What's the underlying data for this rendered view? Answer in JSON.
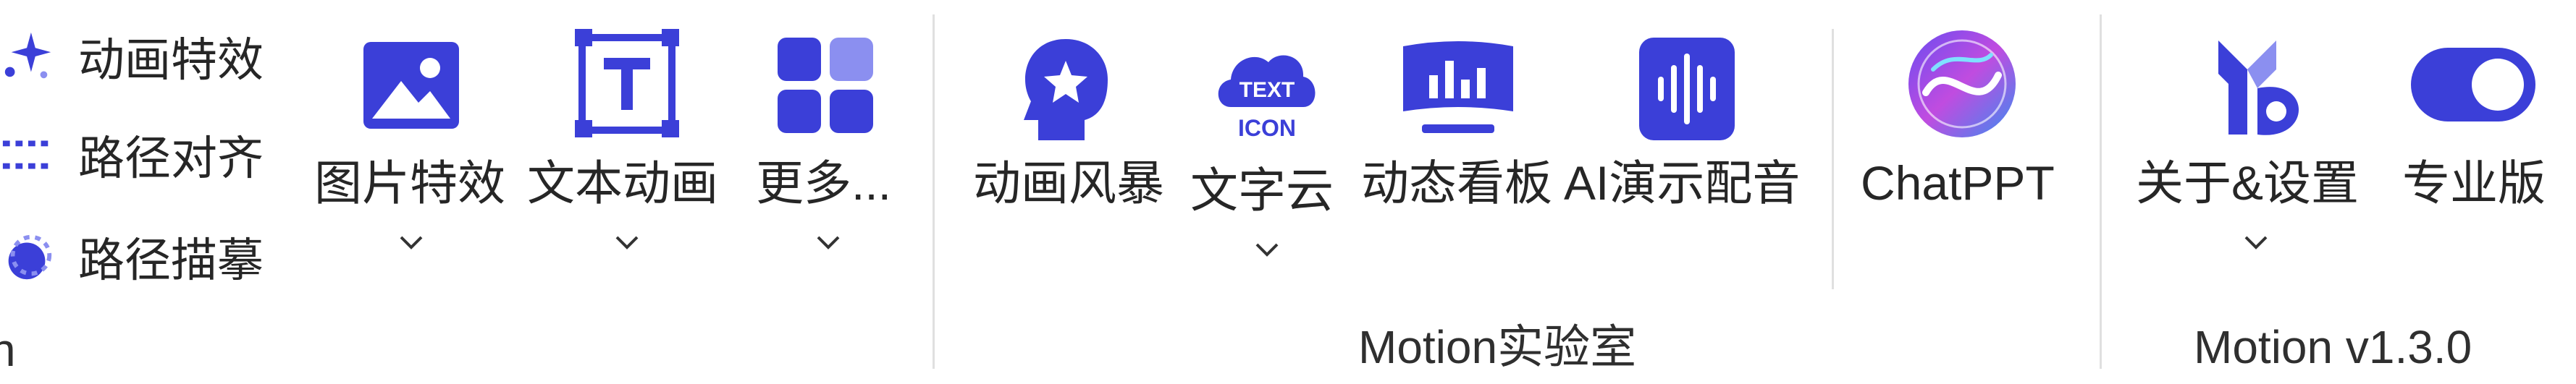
{
  "left_column": {
    "items": [
      {
        "label": "动画特效",
        "icon": "sparkle-icon"
      },
      {
        "label": "路径对齐",
        "icon": "align-path-icon"
      },
      {
        "label": "路径描摹",
        "icon": "trace-path-icon"
      }
    ],
    "clipped_group_title": "n"
  },
  "group1": {
    "buttons": [
      {
        "label": "图片特效",
        "icon": "image-icon"
      },
      {
        "label": "文本动画",
        "icon": "text-box-icon"
      },
      {
        "label": "更多...",
        "icon": "grid-apps-icon"
      }
    ]
  },
  "group2": {
    "buttons": [
      {
        "label": "动画风暴",
        "icon": "head-star-icon"
      },
      {
        "label": "文字云",
        "icon": "text-cloud-icon",
        "icon_text_top": "TEXT",
        "icon_text_bottom": "ICON"
      },
      {
        "label": "动态看板",
        "icon": "dashboard-icon"
      },
      {
        "label": "AI演示配音",
        "icon": "voice-wave-icon"
      },
      {
        "label": "ChatPPT",
        "icon": "chatppt-logo-icon"
      }
    ],
    "title": "Motion实验室"
  },
  "group3": {
    "buttons": [
      {
        "label": "关于&设置",
        "icon": "motion-logo-icon"
      },
      {
        "label": "专业版",
        "icon": "toggle-icon"
      }
    ],
    "title": "Motion v1.3.0"
  },
  "colors": {
    "accent": "#3b3fd8",
    "accent_light": "#8b8ff0",
    "separator": "#e0e0e0"
  }
}
